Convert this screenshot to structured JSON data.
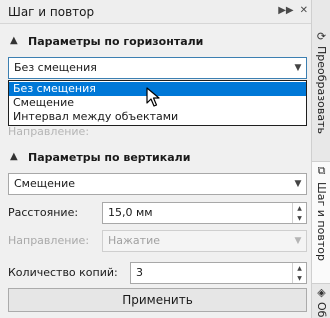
{
  "docker": {
    "title": "Шаг и повтор",
    "icons": [
      "expand-arrows-icon",
      "close-icon"
    ]
  },
  "horizontal_section": {
    "header": "Параметры по горизонтали",
    "mode_combo": {
      "value": "Без смещения"
    },
    "dropdown_options": [
      "Без смещения",
      "Смещение",
      "Интервал между объектами"
    ],
    "selected_index": 0,
    "hidden_label": "Направление:"
  },
  "vertical_section": {
    "header": "Параметры по вертикали",
    "mode_combo": {
      "value": "Смещение"
    },
    "distance": {
      "label": "Расстояние:",
      "value": "15,0 мм"
    },
    "direction": {
      "label": "Направление:",
      "value": "Нажатие"
    }
  },
  "copies": {
    "label": "Количество копий:",
    "value": "3"
  },
  "apply_button": {
    "label": "Применить"
  },
  "right_tabs": [
    {
      "label": "Преобразовать",
      "icon": "transform-icon",
      "active": false
    },
    {
      "label": "Шаг и повтор",
      "icon": "step-repeat-icon",
      "active": true
    },
    {
      "label": "Об",
      "icon": "object-icon",
      "active": false
    }
  ]
}
